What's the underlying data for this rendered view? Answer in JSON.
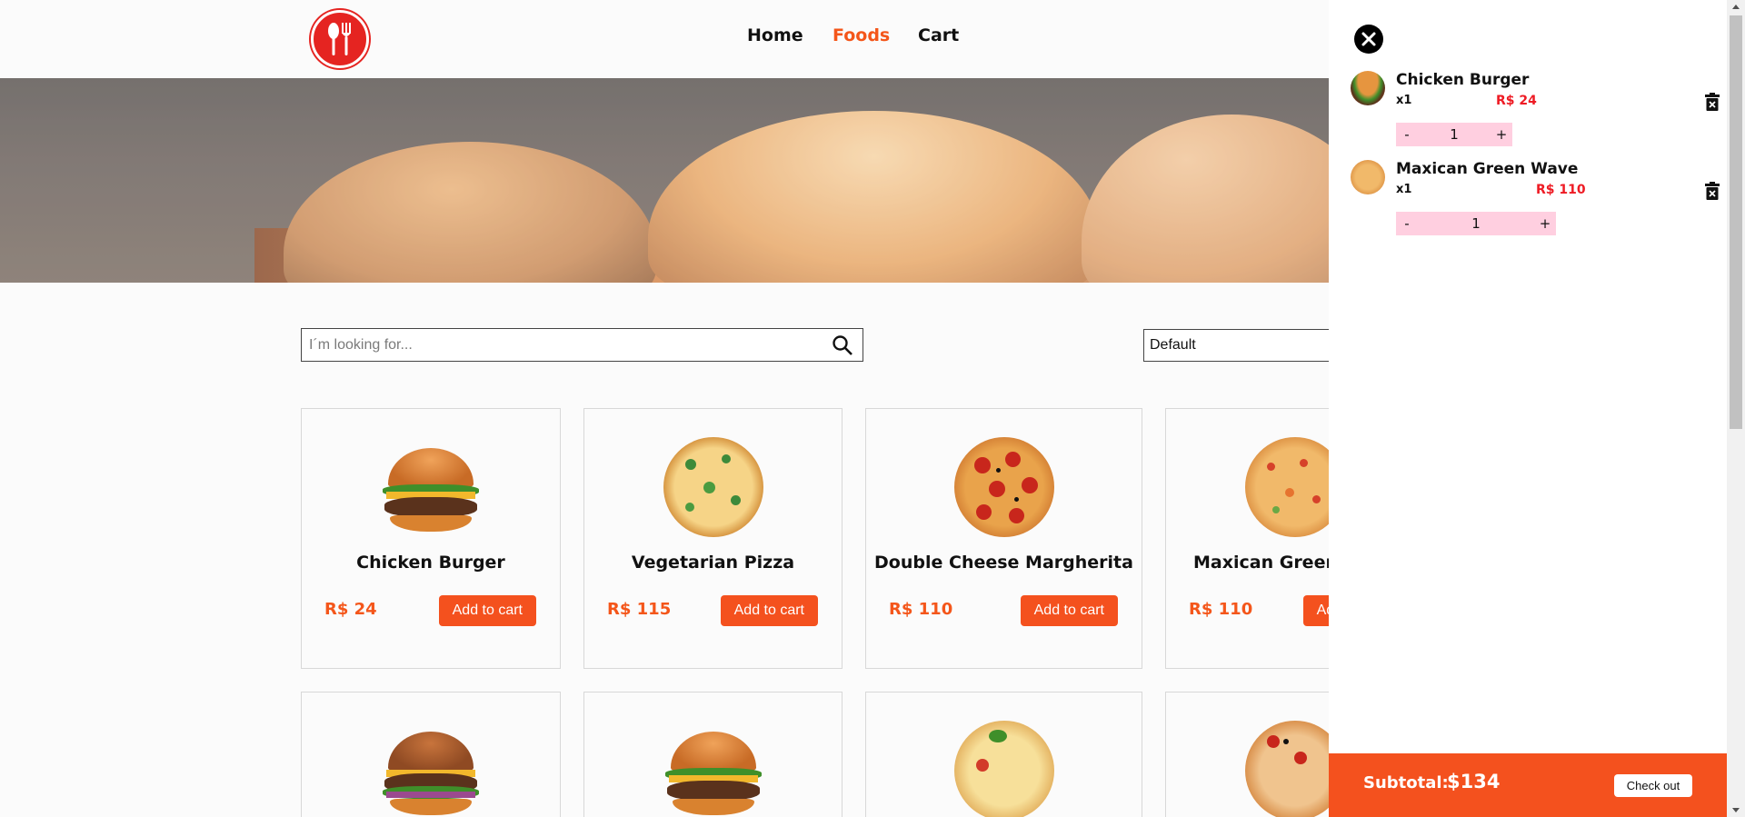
{
  "header": {
    "nav": {
      "home": "Home",
      "foods": "Foods",
      "cart": "Cart"
    }
  },
  "search": {
    "placeholder": "I´m looking for..."
  },
  "sort": {
    "selected": "Default"
  },
  "products": [
    {
      "title": "Chicken Burger",
      "price": "R$ 24",
      "button": "Add to cart",
      "kind": "burger"
    },
    {
      "title": "Vegetarian Pizza",
      "price": "R$ 115",
      "button": "Add to cart",
      "kind": "veg-pizza"
    },
    {
      "title": "Double Cheese Margherita",
      "price": "R$ 110",
      "button": "Add to cart",
      "kind": "pepperoni-pizza"
    },
    {
      "title": "Maxican Green Wave",
      "price": "R$ 110",
      "button": "Add to cart",
      "kind": "mexican-pizza"
    }
  ],
  "cart": {
    "items": [
      {
        "name": "Chicken Burger",
        "qty_label": "x1",
        "price": "R$ 24",
        "minus": "-",
        "quantity": "1",
        "plus": "+"
      },
      {
        "name": "Maxican Green Wave",
        "qty_label": "x1",
        "price": "R$ 110",
        "minus": "-",
        "quantity": "1",
        "plus": "+"
      }
    ],
    "subtotal_label": "Subtotal:",
    "subtotal_amount": "$134",
    "checkout_label": "Check out"
  },
  "colors": {
    "accent": "#f4511e",
    "price_red": "#ee1b24",
    "logo_red": "#e52421",
    "stepper_pink": "#ffcfe0"
  },
  "icons": [
    "close-icon",
    "search-icon",
    "trash-icon",
    "restaurant-logo-icon"
  ]
}
